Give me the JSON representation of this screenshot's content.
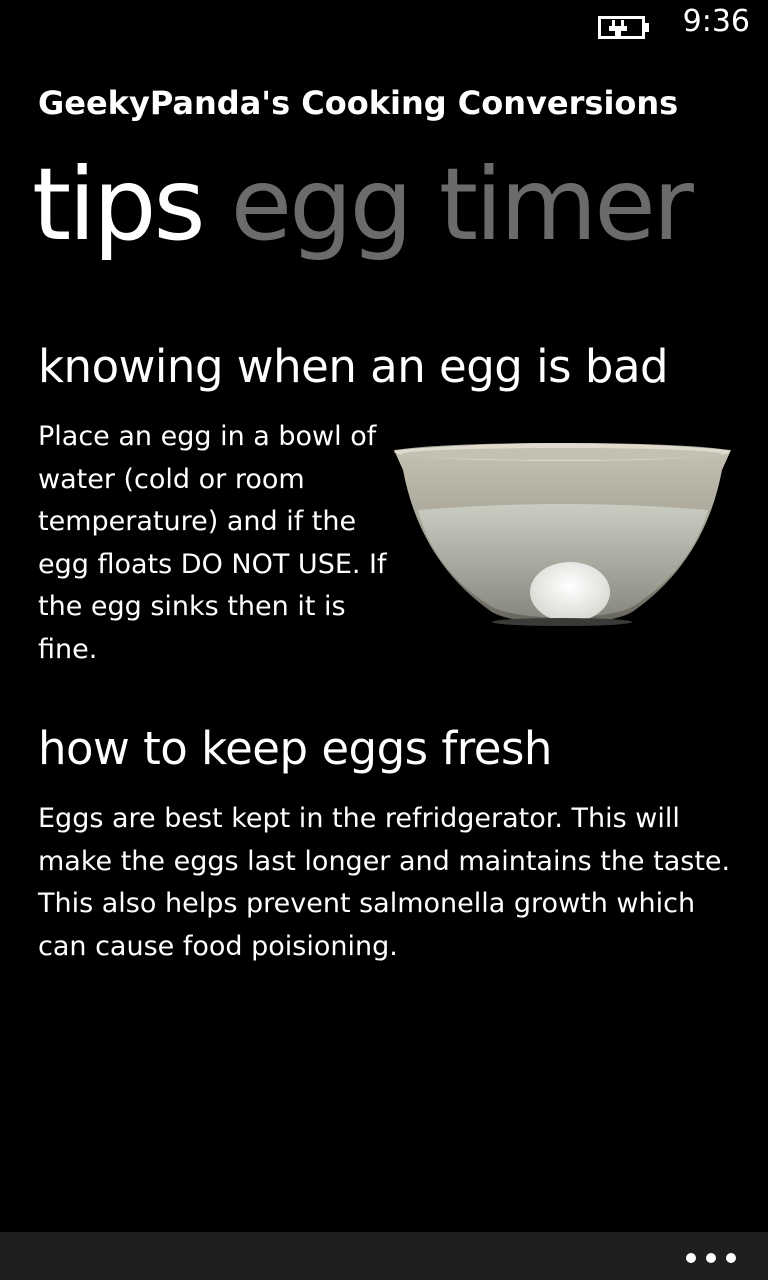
{
  "status_bar": {
    "time": "9:36",
    "battery_icon": "battery-charging-icon"
  },
  "app": {
    "title": "GeekyPanda's Cooking Conversions"
  },
  "pivot": {
    "items": [
      {
        "label": "tips",
        "active": true
      },
      {
        "label": "egg timer",
        "active": false
      }
    ]
  },
  "sections": [
    {
      "heading": "knowing when an egg is bad",
      "body": "Place an egg in a bowl of water (cold or room temperature) and if the egg floats DO NOT USE. If the egg sinks then it is fine.",
      "image": "bowl-of-water-with-egg"
    },
    {
      "heading": "how to keep eggs fresh",
      "body": "Eggs are best kept in the refridgerator. This will make the eggs last longer and maintains the taste. This also helps prevent salmonella growth which can cause food poisioning."
    }
  ],
  "app_bar": {
    "more_icon": "more-ellipsis-icon"
  },
  "colors": {
    "background": "#000000",
    "text": "#ffffff",
    "inactive_pivot": "#6b6b6b",
    "app_bar": "#1f1f1f"
  }
}
